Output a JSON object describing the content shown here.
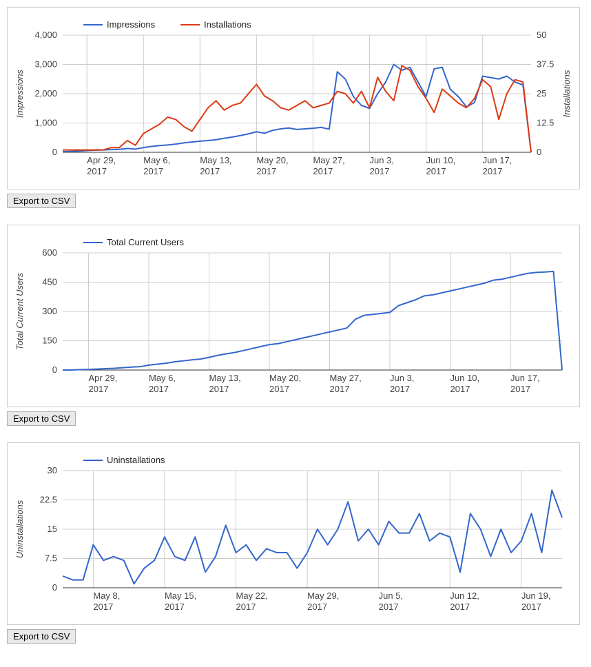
{
  "chart_data": [
    {
      "type": "line",
      "categories": [
        "Apr 26, 2017",
        "Apr 27, 2017",
        "Apr 28, 2017",
        "Apr 29, 2017",
        "Apr 30, 2017",
        "May 1, 2017",
        "May 2, 2017",
        "May 3, 2017",
        "May 4, 2017",
        "May 5, 2017",
        "May 6, 2017",
        "May 7, 2017",
        "May 8, 2017",
        "May 9, 2017",
        "May 10, 2017",
        "May 11, 2017",
        "May 12, 2017",
        "May 13, 2017",
        "May 14, 2017",
        "May 15, 2017",
        "May 16, 2017",
        "May 17, 2017",
        "May 18, 2017",
        "May 19, 2017",
        "May 20, 2017",
        "May 21, 2017",
        "May 22, 2017",
        "May 23, 2017",
        "May 24, 2017",
        "May 25, 2017",
        "May 26, 2017",
        "May 27, 2017",
        "May 28, 2017",
        "May 29, 2017",
        "May 30, 2017",
        "May 31, 2017",
        "Jun 1, 2017",
        "Jun 2, 2017",
        "Jun 3, 2017",
        "Jun 4, 2017",
        "Jun 5, 2017",
        "Jun 6, 2017",
        "Jun 7, 2017",
        "Jun 8, 2017",
        "Jun 9, 2017",
        "Jun 10, 2017",
        "Jun 11, 2017",
        "Jun 12, 2017",
        "Jun 13, 2017",
        "Jun 14, 2017",
        "Jun 15, 2017",
        "Jun 16, 2017",
        "Jun 17, 2017",
        "Jun 18, 2017",
        "Jun 19, 2017",
        "Jun 20, 2017",
        "Jun 21, 2017",
        "Jun 22, 2017",
        "Jun 23, 2017"
      ],
      "series": [
        {
          "name": "Impressions",
          "axis": "left",
          "color": "#3366CC",
          "values": [
            20,
            30,
            40,
            60,
            70,
            80,
            90,
            100,
            130,
            110,
            160,
            200,
            230,
            250,
            280,
            320,
            350,
            380,
            400,
            430,
            480,
            520,
            570,
            630,
            700,
            650,
            750,
            800,
            830,
            780,
            800,
            820,
            850,
            790,
            2750,
            2500,
            1900,
            1600,
            1500,
            2000,
            2400,
            3000,
            2800,
            2900,
            2400,
            1900,
            2850,
            2900,
            2150,
            1900,
            1550,
            1700,
            2600,
            2550,
            2500,
            2600,
            2400,
            2300,
            0
          ]
        },
        {
          "name": "Installations",
          "axis": "right",
          "color": "#DC3912",
          "values": [
            1,
            1,
            1,
            1,
            1,
            1,
            2,
            2,
            5,
            3,
            8,
            10,
            12,
            15,
            14,
            11,
            9,
            14,
            19,
            22,
            18,
            20,
            21,
            25,
            29,
            24,
            22,
            19,
            18,
            20,
            22,
            19,
            20,
            21,
            26,
            25,
            21,
            26,
            19,
            32,
            26,
            22,
            37,
            35,
            28,
            23,
            17,
            27,
            24,
            21,
            19,
            23,
            31,
            28,
            14,
            25,
            31,
            30,
            0
          ]
        }
      ],
      "left_ylabel": "Impressions",
      "right_ylabel": "Installations",
      "left_ylim": [
        0,
        4000
      ],
      "right_ylim": [
        0,
        50
      ],
      "left_yticks": [
        0,
        1000,
        2000,
        3000,
        4000
      ],
      "right_yticks": [
        0.0,
        12.5,
        25.0,
        37.5,
        50.0
      ],
      "xticks": [
        "Apr 29, 2017",
        "May 6, 2017",
        "May 13, 2017",
        "May 20, 2017",
        "May 27, 2017",
        "Jun 3, 2017",
        "Jun 10, 2017",
        "Jun 17, 2017"
      ],
      "legend": [
        "Impressions",
        "Installations"
      ]
    },
    {
      "type": "line",
      "categories": [
        "Apr 26, 2017",
        "Apr 27, 2017",
        "Apr 28, 2017",
        "Apr 29, 2017",
        "Apr 30, 2017",
        "May 1, 2017",
        "May 2, 2017",
        "May 3, 2017",
        "May 4, 2017",
        "May 5, 2017",
        "May 6, 2017",
        "May 7, 2017",
        "May 8, 2017",
        "May 9, 2017",
        "May 10, 2017",
        "May 11, 2017",
        "May 12, 2017",
        "May 13, 2017",
        "May 14, 2017",
        "May 15, 2017",
        "May 16, 2017",
        "May 17, 2017",
        "May 18, 2017",
        "May 19, 2017",
        "May 20, 2017",
        "May 21, 2017",
        "May 22, 2017",
        "May 23, 2017",
        "May 24, 2017",
        "May 25, 2017",
        "May 26, 2017",
        "May 27, 2017",
        "May 28, 2017",
        "May 29, 2017",
        "May 30, 2017",
        "May 31, 2017",
        "Jun 1, 2017",
        "Jun 2, 2017",
        "Jun 3, 2017",
        "Jun 4, 2017",
        "Jun 5, 2017",
        "Jun 6, 2017",
        "Jun 7, 2017",
        "Jun 8, 2017",
        "Jun 9, 2017",
        "Jun 10, 2017",
        "Jun 11, 2017",
        "Jun 12, 2017",
        "Jun 13, 2017",
        "Jun 14, 2017",
        "Jun 15, 2017",
        "Jun 16, 2017",
        "Jun 17, 2017",
        "Jun 18, 2017",
        "Jun 19, 2017",
        "Jun 20, 2017",
        "Jun 21, 2017",
        "Jun 22, 2017",
        "Jun 23, 2017"
      ],
      "series": [
        {
          "name": "Total Current Users",
          "color": "#3366CC",
          "values": [
            0,
            0,
            2,
            3,
            5,
            7,
            9,
            12,
            15,
            17,
            25,
            30,
            35,
            42,
            47,
            52,
            56,
            65,
            75,
            83,
            90,
            100,
            110,
            120,
            130,
            135,
            145,
            155,
            165,
            175,
            185,
            195,
            205,
            215,
            260,
            280,
            285,
            290,
            295,
            330,
            345,
            360,
            380,
            385,
            395,
            405,
            415,
            425,
            435,
            445,
            460,
            465,
            475,
            485,
            495,
            500,
            502,
            505,
            0
          ]
        }
      ],
      "ylabel": "Total Current Users",
      "ylim": [
        0,
        600
      ],
      "yticks": [
        0,
        150,
        300,
        450,
        600
      ],
      "xticks": [
        "Apr 29, 2017",
        "May 6, 2017",
        "May 13, 2017",
        "May 20, 2017",
        "May 27, 2017",
        "Jun 3, 2017",
        "Jun 10, 2017",
        "Jun 17, 2017"
      ],
      "legend": [
        "Total Current Users"
      ]
    },
    {
      "type": "line",
      "categories": [
        "May 5, 2017",
        "May 6, 2017",
        "May 7, 2017",
        "May 8, 2017",
        "May 9, 2017",
        "May 10, 2017",
        "May 11, 2017",
        "May 12, 2017",
        "May 13, 2017",
        "May 14, 2017",
        "May 15, 2017",
        "May 16, 2017",
        "May 17, 2017",
        "May 18, 2017",
        "May 19, 2017",
        "May 20, 2017",
        "May 21, 2017",
        "May 22, 2017",
        "May 23, 2017",
        "May 24, 2017",
        "May 25, 2017",
        "May 26, 2017",
        "May 27, 2017",
        "May 28, 2017",
        "May 29, 2017",
        "May 30, 2017",
        "May 31, 2017",
        "Jun 1, 2017",
        "Jun 2, 2017",
        "Jun 3, 2017",
        "Jun 4, 2017",
        "Jun 5, 2017",
        "Jun 6, 2017",
        "Jun 7, 2017",
        "Jun 8, 2017",
        "Jun 9, 2017",
        "Jun 10, 2017",
        "Jun 11, 2017",
        "Jun 12, 2017",
        "Jun 13, 2017",
        "Jun 14, 2017",
        "Jun 15, 2017",
        "Jun 16, 2017",
        "Jun 17, 2017",
        "Jun 18, 2017",
        "Jun 19, 2017",
        "Jun 20, 2017",
        "Jun 21, 2017",
        "Jun 22, 2017",
        "Jun 23, 2017"
      ],
      "series": [
        {
          "name": "Uninstallations",
          "color": "#3366CC",
          "values": [
            3,
            2,
            2,
            11,
            7,
            8,
            7,
            1,
            5,
            7,
            13,
            8,
            7,
            13,
            4,
            8,
            16,
            9,
            11,
            7,
            10,
            9,
            9,
            5,
            9,
            15,
            11,
            15,
            22,
            12,
            15,
            11,
            17,
            14,
            14,
            19,
            12,
            14,
            13,
            4,
            19,
            15,
            8,
            15,
            9,
            12,
            19,
            9,
            25,
            18,
            14,
            0
          ]
        }
      ],
      "ylabel": "Uninstallations",
      "ylim": [
        0,
        30
      ],
      "yticks": [
        0.0,
        7.5,
        15.0,
        22.5,
        30.0
      ],
      "xticks": [
        "May 8, 2017",
        "May 15, 2017",
        "May 22, 2017",
        "May 29, 2017",
        "Jun 5, 2017",
        "Jun 12, 2017",
        "Jun 19, 2017"
      ],
      "legend": [
        "Uninstallations"
      ]
    }
  ],
  "buttons": {
    "export": "Export to CSV"
  }
}
